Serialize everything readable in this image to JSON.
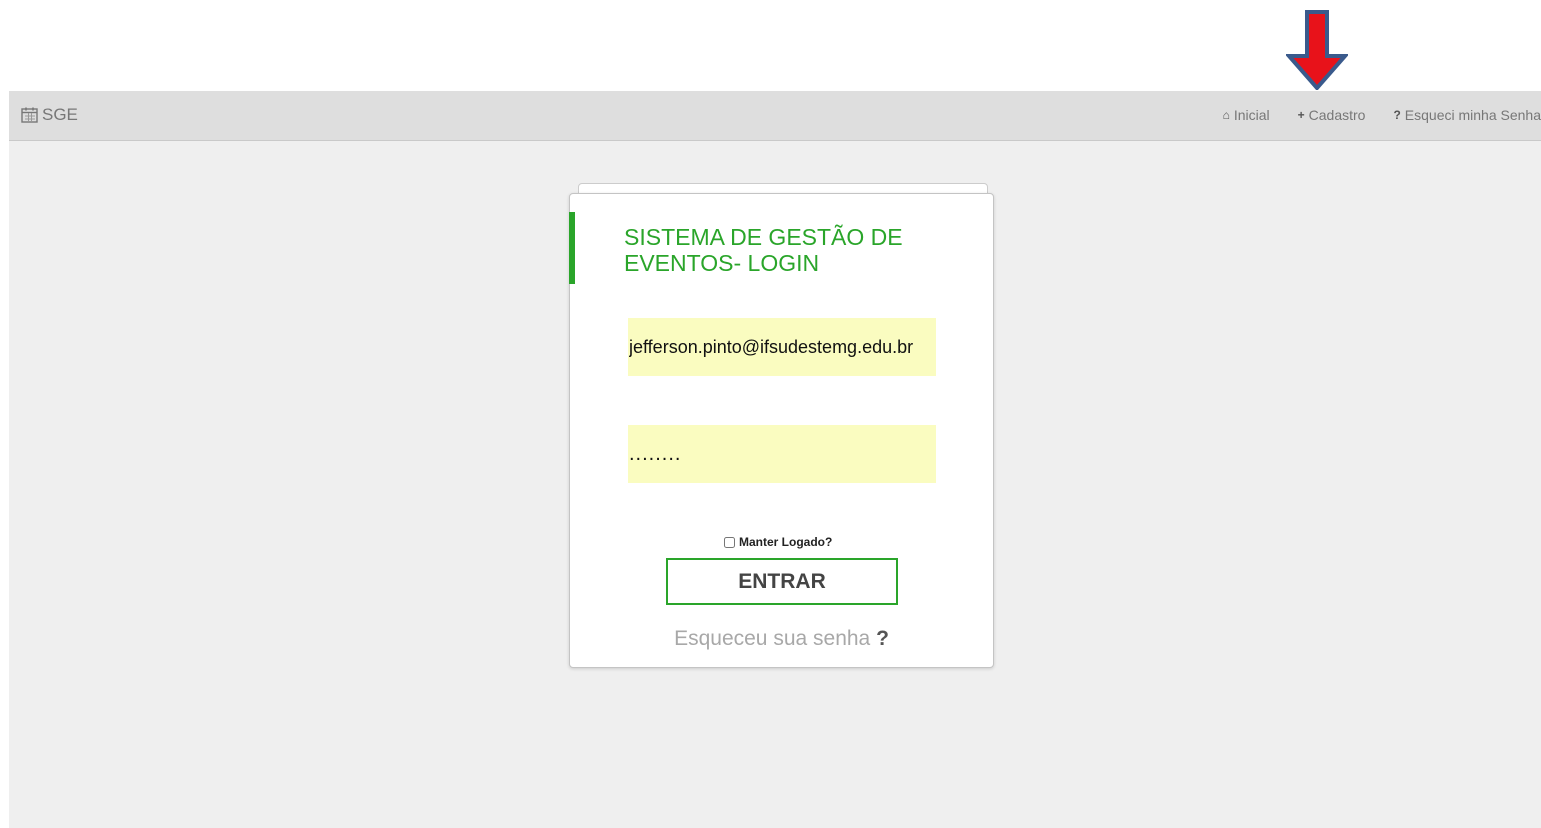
{
  "app": {
    "brand": "SGE",
    "brand_icon": "calendar-icon"
  },
  "nav": {
    "items": [
      {
        "icon": "home-icon",
        "glyph": "⌂",
        "label": "Inicial"
      },
      {
        "icon": "plus-icon",
        "glyph": "+",
        "label": "Cadastro"
      },
      {
        "icon": "question-icon",
        "glyph": "?",
        "label": "Esqueci minha Senha"
      }
    ]
  },
  "login": {
    "title_line1": "SISTEMA DE GESTÃO DE",
    "title_line2": "EVENTOS- LOGIN",
    "email_value": "jefferson.pinto@ifsudestemg.edu.br",
    "password_value": "........",
    "keep_logged_label": "Manter Logado?",
    "submit_label": "ENTRAR",
    "forgot_label": "Esqueceu sua senha",
    "forgot_mark": "?"
  },
  "colors": {
    "accent_green": "#2aa52a",
    "navbar_bg": "#dedede",
    "page_bg": "#efefef",
    "field_bg": "#fafcc0",
    "arrow_fill": "#e8121a",
    "arrow_outline": "#3a5a8c"
  },
  "annotation": {
    "arrow_icon": "down-arrow-icon"
  }
}
